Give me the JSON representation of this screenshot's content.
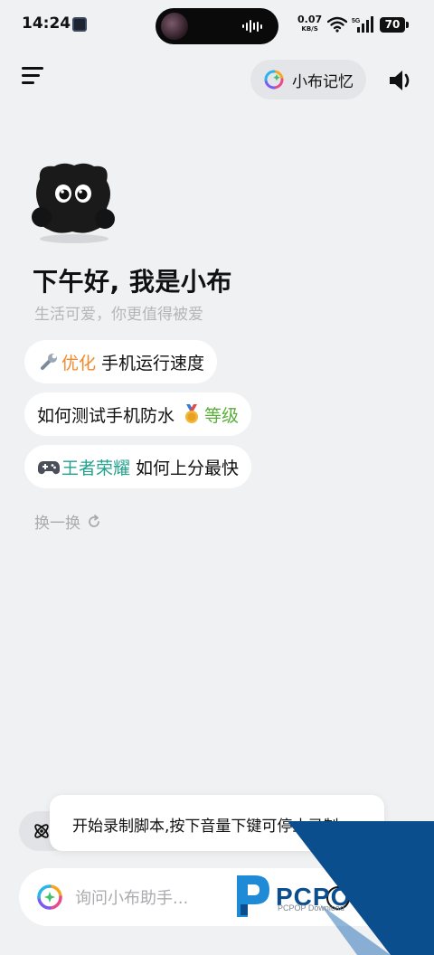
{
  "status_bar": {
    "time": "14:24",
    "net_speed": "0.07",
    "net_unit": "KB/S",
    "signal_label": "5G",
    "battery": "70"
  },
  "header": {
    "memory_label": "小布记忆"
  },
  "greeting": {
    "title": "下午好, 我是小布",
    "subtitle": "生活可爱，你更值得被爱"
  },
  "suggestions": [
    {
      "icon": "wrench-icon",
      "highlight": "优化",
      "text": " 手机运行速度"
    },
    {
      "text": "如何测试手机防水 ",
      "icon": "medal-icon",
      "highlight": "等级"
    },
    {
      "icon": "gamepad-icon",
      "highlight": "王者荣耀",
      "text": " 如何上分最快"
    }
  ],
  "refresh_label": "换一换",
  "toast": {
    "message": "开始录制脚本,按下音量下键可停止录制"
  },
  "input": {
    "placeholder": "询问小布助手..."
  },
  "watermark": {
    "brand": "PCPOP下载",
    "sub": "PCPOP Download"
  },
  "colors": {
    "background": "#f0f1f3",
    "highlight_orange": "#f08a2c",
    "highlight_green": "#5aae3a",
    "highlight_teal": "#22a28c",
    "watermark_blue": "#0b4e8e"
  }
}
